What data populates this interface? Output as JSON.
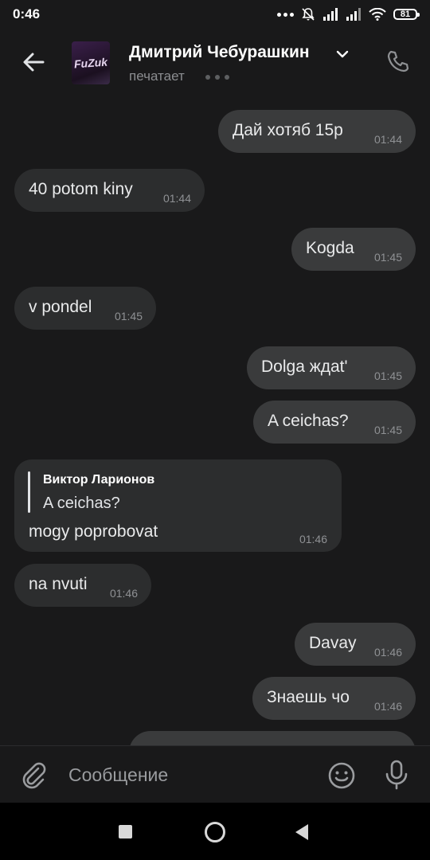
{
  "status_bar": {
    "time": "0:46",
    "battery": "81"
  },
  "header": {
    "contact_name": "Дмитрий Чебурашкин",
    "status": "печатает",
    "avatar_text": "FuZuk"
  },
  "messages": [
    {
      "text": "Дай хотяб 15р",
      "time": "01:44",
      "direction": "out"
    },
    {
      "text": "40 potom kiny",
      "time": "01:44",
      "direction": "in"
    },
    {
      "text": "Kogda",
      "time": "01:45",
      "direction": "out"
    },
    {
      "text": "v pondel",
      "time": "01:45",
      "direction": "in"
    },
    {
      "text": "Dolga ждat'",
      "time": "01:45",
      "direction": "out"
    },
    {
      "text": "A ceichas?",
      "time": "01:45",
      "direction": "out"
    },
    {
      "text": "na nvuti",
      "time": "01:46",
      "direction": "in"
    },
    {
      "text": "Davay",
      "time": "01:46",
      "direction": "out"
    },
    {
      "text": "Знаешь чо",
      "time": "01:46",
      "direction": "out"
    }
  ],
  "reply_message": {
    "quoted_author": "Виктор Ларионов",
    "quoted_text": "A ceichas?",
    "text": "mogy poprobovat",
    "time": "01:46"
  },
  "composer": {
    "placeholder": "Сообщение"
  },
  "colors": {
    "background": "#19191a",
    "incoming_bubble": "#2c2d2e",
    "outgoing_bubble": "#3a3b3c"
  }
}
